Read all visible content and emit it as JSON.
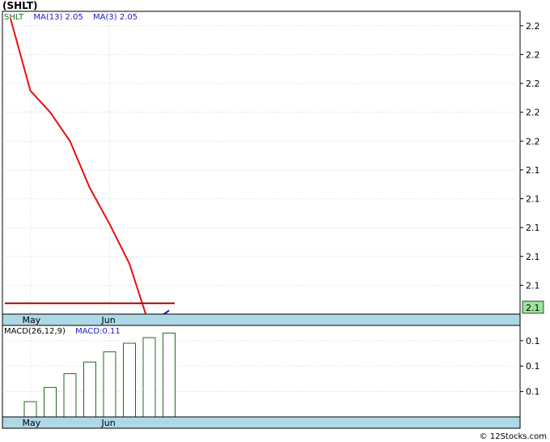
{
  "header": {
    "title": "(SHLT)"
  },
  "footer": {
    "copyright": "© 12Stocks.com"
  },
  "colors": {
    "price_line": "#e81010",
    "ma3_line": "#1a1acc",
    "ma13_line": "#e81010",
    "macd_bar": "#1f6b1f",
    "axis_band": "#add8e6",
    "grid": "#c0c0c0",
    "last_price_badge": "#9be39b",
    "legend_symbol": "#1f6b1f",
    "legend_ma": "#1a1acc"
  },
  "legend": {
    "symbol": "SHLT",
    "ma13": "MA(13)  2.05",
    "ma3": "MA(3)  2.05"
  },
  "macd_legend": {
    "params": "MACD(26,12,9)",
    "value": "MACD:0.11"
  },
  "chart_data": [
    {
      "type": "line",
      "title": "(SHLT)",
      "x_labels": [
        "May",
        "Jun"
      ],
      "x_label_index": [
        1,
        5
      ],
      "y_tick_labels": [
        "2.2",
        "2.2",
        "2.2",
        "2.2",
        "2.2",
        "2.1",
        "2.1",
        "2.1",
        "2.1",
        "2.1"
      ],
      "y_tick_values": [
        2.211,
        2.203,
        2.195,
        2.187,
        2.179,
        2.171,
        2.163,
        2.155,
        2.147,
        2.139
      ],
      "ylim": [
        2.131,
        2.215
      ],
      "last_price_label": "2.1",
      "last_price": 2.134,
      "grid": true,
      "series": [
        {
          "name": "SHLT",
          "color": "#e81010",
          "values": [
            2.213,
            2.193,
            2.187,
            2.179,
            2.166,
            2.156,
            2.145,
            2.128,
            2.132
          ]
        },
        {
          "name": "MA(13)",
          "color": "#e81010",
          "x_index": [
            0,
            8
          ],
          "values": [
            2.134,
            2.134
          ]
        },
        {
          "name": "MA(3)",
          "color": "#1a1acc",
          "x_index": [
            7,
            8
          ],
          "values": [
            2.128,
            2.132
          ]
        }
      ]
    },
    {
      "type": "bar",
      "title": "MACD(26,12,9)",
      "x_labels": [
        "May",
        "Jun"
      ],
      "x_label_index": [
        1,
        5
      ],
      "y_tick_labels": [
        "0.1",
        "0.1",
        "0.1"
      ],
      "y_tick_values": [
        0.15,
        0.1,
        0.05
      ],
      "ylim": [
        0.0,
        0.18
      ],
      "grid": true,
      "series": [
        {
          "name": "MACD",
          "color": "#1f6b1f",
          "values": [
            0.03,
            0.058,
            0.085,
            0.108,
            0.128,
            0.145,
            0.156,
            0.165
          ]
        }
      ]
    }
  ]
}
